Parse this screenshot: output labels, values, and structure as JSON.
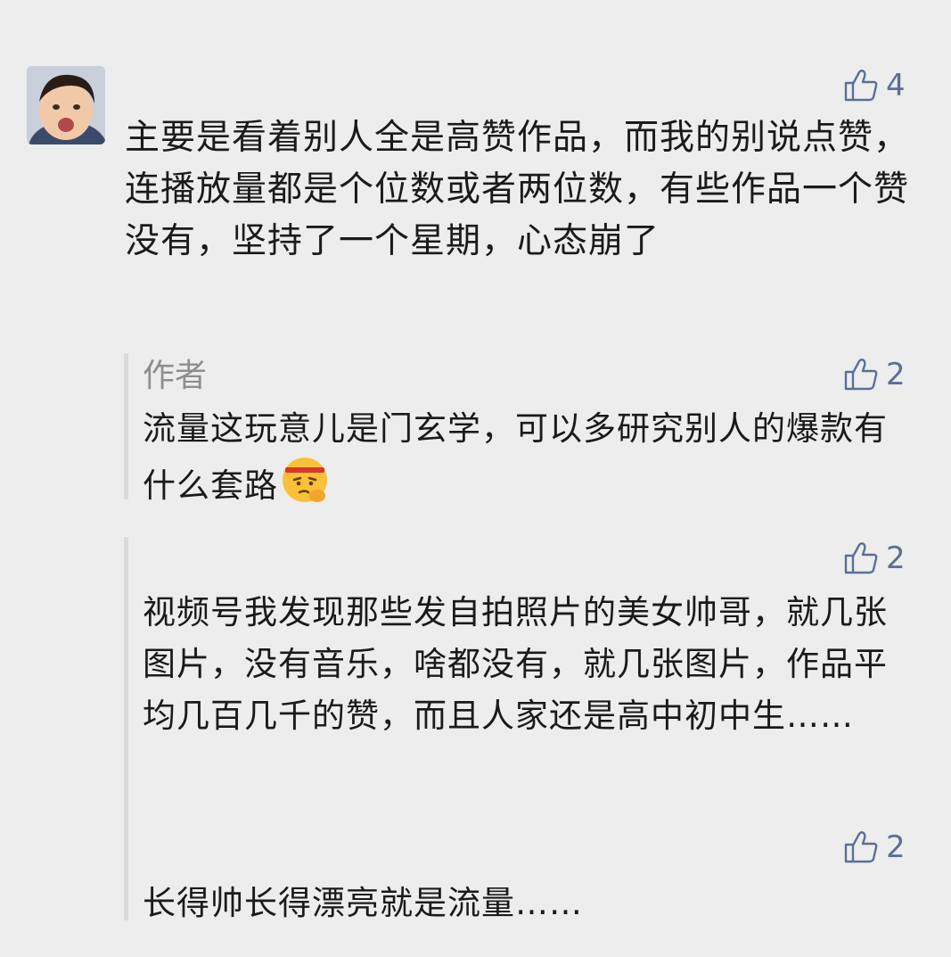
{
  "comment": {
    "likes": "4",
    "text": "主要是看着别人全是高赞作品，而我的别说点赞，连播放量都是个位数或者两位数，有些作品一个赞没有，坚持了一个星期，心态崩了"
  },
  "replies": [
    {
      "author_label": "作者",
      "likes": "2",
      "text": "流量这玩意儿是门玄学，可以多研究别人的爆款有什么套路",
      "emoji": "thinking-face-emoji"
    },
    {
      "likes": "2",
      "text": "视频号我发现那些发自拍照片的美女帅哥，就几张图片，没有音乐，啥都没有，就几张图片，作品平均几百几千的赞，而且人家还是高中初中生……"
    },
    {
      "likes": "2",
      "text": "长得帅长得漂亮就是流量……"
    }
  ],
  "colors": {
    "background": "#ededed",
    "like_icon": "#5b6f96",
    "thread_line": "#dadada",
    "author_label": "#8e8e8e"
  },
  "icons": [
    "thumbs-up-icon"
  ]
}
